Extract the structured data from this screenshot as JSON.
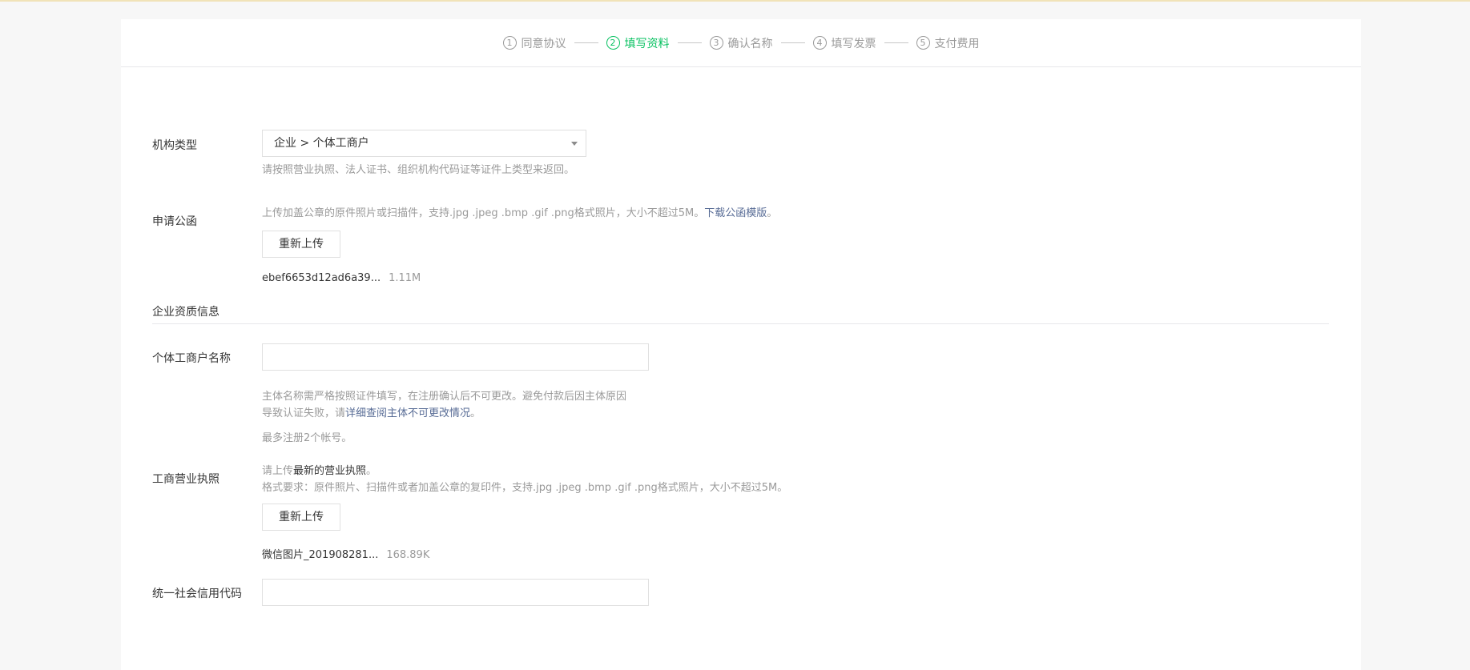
{
  "steps": [
    {
      "num": "1",
      "label": "同意协议",
      "active": false
    },
    {
      "num": "2",
      "label": "填写资料",
      "active": true
    },
    {
      "num": "3",
      "label": "确认名称",
      "active": false
    },
    {
      "num": "4",
      "label": "填写发票",
      "active": false
    },
    {
      "num": "5",
      "label": "支付费用",
      "active": false
    }
  ],
  "org_type": {
    "label": "机构类型",
    "value": "企业 > 个体工商户",
    "tip": "请按照营业执照、法人证书、组织机构代码证等证件上类型来返回。"
  },
  "letter": {
    "label": "申请公函",
    "tip": "上传加盖公章的原件照片或扫描件，支持.jpg .jpeg .bmp .gif .png格式照片，大小不超过5M。",
    "tip_link": "下载公函模版",
    "tip_end": "。",
    "button": "重新上传",
    "file_name": "ebef6653d12ad6a39...",
    "file_size": "1.11M"
  },
  "section": {
    "title": "企业资质信息"
  },
  "biz_name": {
    "label": "个体工商户名称",
    "value": "",
    "tip_line1": "主体名称需严格按照证件填写，在注册确认后不可更改。避免付款后因主体原因",
    "tip_line2": "导致认证失败，请",
    "tip_line2_link": "详细查阅主体不可更改情况",
    "tip_line2_end": "。",
    "tip_limit": "最多注册2个帐号。"
  },
  "license": {
    "label": "工商营业执照",
    "tip_line1_pre": "请上传",
    "tip_line1_strong": "最新的营业执照",
    "tip_line1_end": "。",
    "tip_line2": "格式要求：原件照片、扫描件或者加盖公章的复印件，支持.jpg .jpeg .bmp .gif .png格式照片，大小不超过5M。",
    "button": "重新上传",
    "file_name": "微信图片_201908281...",
    "file_size": "168.89K"
  },
  "credit_code": {
    "label": "统一社会信用代码",
    "value": ""
  },
  "colors": {
    "accent": "#07c160",
    "link": "#576b95"
  }
}
